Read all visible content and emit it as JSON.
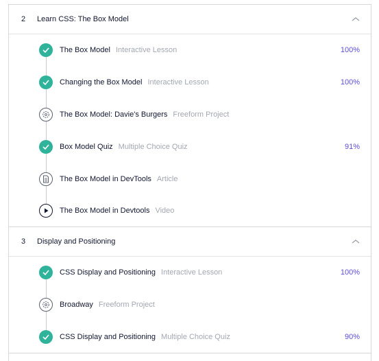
{
  "sections": [
    {
      "number": "2",
      "title": "Learn CSS: The Box Model",
      "items": [
        {
          "title": "The Box Model",
          "type": "Interactive Lesson",
          "score": "100%",
          "icon": "check-icon"
        },
        {
          "title": "Changing the Box Model",
          "type": "Interactive Lesson",
          "score": "100%",
          "icon": "check-icon"
        },
        {
          "title": "The Box Model: Davie's Burgers",
          "type": "Freeform Project",
          "score": "",
          "icon": "project-icon"
        },
        {
          "title": "Box Model Quiz",
          "type": "Multiple Choice Quiz",
          "score": "91%",
          "icon": "check-icon"
        },
        {
          "title": "The Box Model in DevTools",
          "type": "Article",
          "score": "",
          "icon": "article-icon"
        },
        {
          "title": "The Box Model in Devtools",
          "type": "Video",
          "score": "",
          "icon": "play-icon"
        }
      ]
    },
    {
      "number": "3",
      "title": "Display and Positioning",
      "items": [
        {
          "title": "CSS Display and Positioning",
          "type": "Interactive Lesson",
          "score": "100%",
          "icon": "check-icon"
        },
        {
          "title": "Broadway",
          "type": "Freeform Project",
          "score": "",
          "icon": "project-icon"
        },
        {
          "title": "CSS Display and Positioning",
          "type": "Multiple Choice Quiz",
          "score": "90%",
          "icon": "check-icon"
        }
      ]
    }
  ],
  "colors": {
    "complete": "#2fb39b",
    "score": "#5b4cdb",
    "muted_text": "#a3a7b3"
  }
}
